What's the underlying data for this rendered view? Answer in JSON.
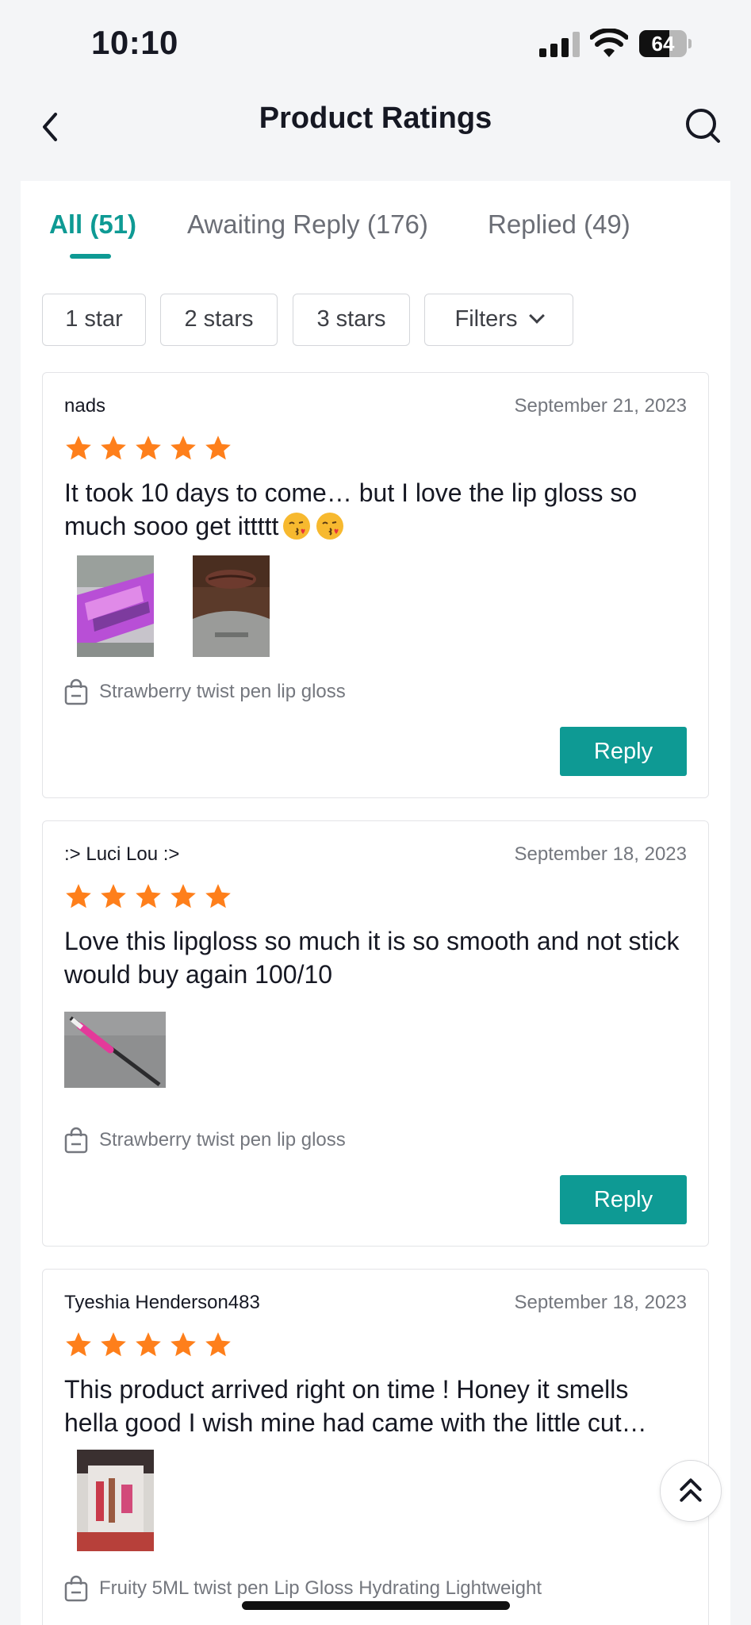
{
  "status_bar": {
    "time": "10:10",
    "battery_level": "64",
    "battery_fraction": 0.64
  },
  "header": {
    "title": "Product Ratings",
    "back_icon": "chevron-left-icon",
    "search_icon": "search-icon"
  },
  "tabs": [
    {
      "label": "All (51)",
      "active": true
    },
    {
      "label": "Awaiting Reply (176)",
      "active": false
    },
    {
      "label": "Replied (49)",
      "active": false
    }
  ],
  "filters": {
    "chips": [
      "1 star",
      "2 stars",
      "3 stars"
    ],
    "filters_label": "Filters",
    "filters_icon": "chevron-down-icon"
  },
  "colors": {
    "accent": "#0e9a94",
    "star": "#fe7f1b",
    "muted_text": "#74777e",
    "background": "#f4f5f7"
  },
  "reviews": [
    {
      "reviewer": "nads",
      "date": "September 21, 2023",
      "rating": 5,
      "text": "It took 10 days to come… but I love the lip gloss so much sooo get ittttt",
      "emojis": [
        "kissing-face-icon",
        "kissing-face-icon"
      ],
      "photo_count": 2,
      "product": "Strawberry twist pen lip gloss",
      "reply_label": "Reply"
    },
    {
      "reviewer": ":> Luci Lou :>",
      "date": "September 18, 2023",
      "rating": 5,
      "text": "Love this lipgloss so much it is so smooth and not stick would buy again 100/10",
      "photo_count": 1,
      "product": "Strawberry twist pen lip gloss",
      "reply_label": "Reply"
    },
    {
      "reviewer": "Tyeshia Henderson483",
      "date": "September 18, 2023",
      "rating": 5,
      "text_line1": "This product arrived right on time ! Honey it smells",
      "text_line2": "hella good I wish mine had came with the little cut…",
      "photo_count": 1,
      "product": "Fruity 5ML twist pen Lip Gloss Hydrating Lightweight"
    }
  ],
  "scroll_top_icon": "double-chevron-up-icon"
}
